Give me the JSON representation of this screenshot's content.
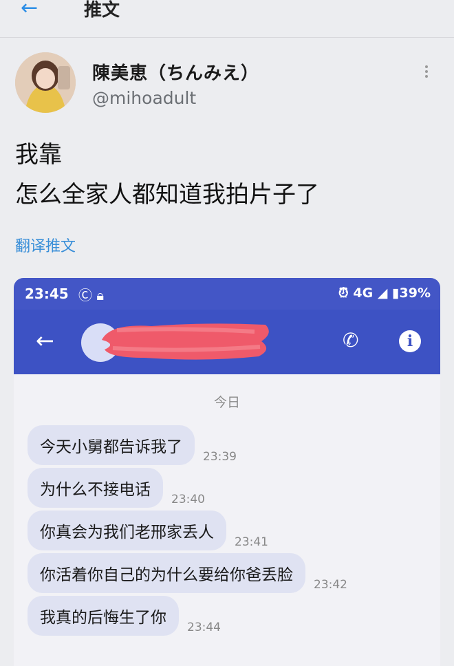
{
  "header": {
    "back_icon": "arrow-left-icon",
    "title": "推文"
  },
  "author": {
    "display_name": "陳美恵（ちんみえ）",
    "handle": "@mihoadult"
  },
  "tweet": {
    "line1": "我靠",
    "line2": "怎么全家人都知道我拍片子了",
    "translate_label": "翻译推文"
  },
  "phone": {
    "status": {
      "time": "23:45",
      "right": "39%",
      "network": "4G"
    },
    "colors": {
      "bar": "#3d52c4",
      "bubble": "#dfe2f2"
    },
    "date_label": "今日",
    "messages": [
      {
        "text": "今天小舅都告诉我了",
        "time": "23:39"
      },
      {
        "text": "为什么不接电话",
        "time": "23:40"
      },
      {
        "text": "你真会为我们老邢家丢人",
        "time": "23:41"
      },
      {
        "text": "你活着你自己的为什么要给你爸丢脸",
        "time": "23:42"
      },
      {
        "text": "我真的后悔生了你",
        "time": "23:44"
      }
    ]
  }
}
